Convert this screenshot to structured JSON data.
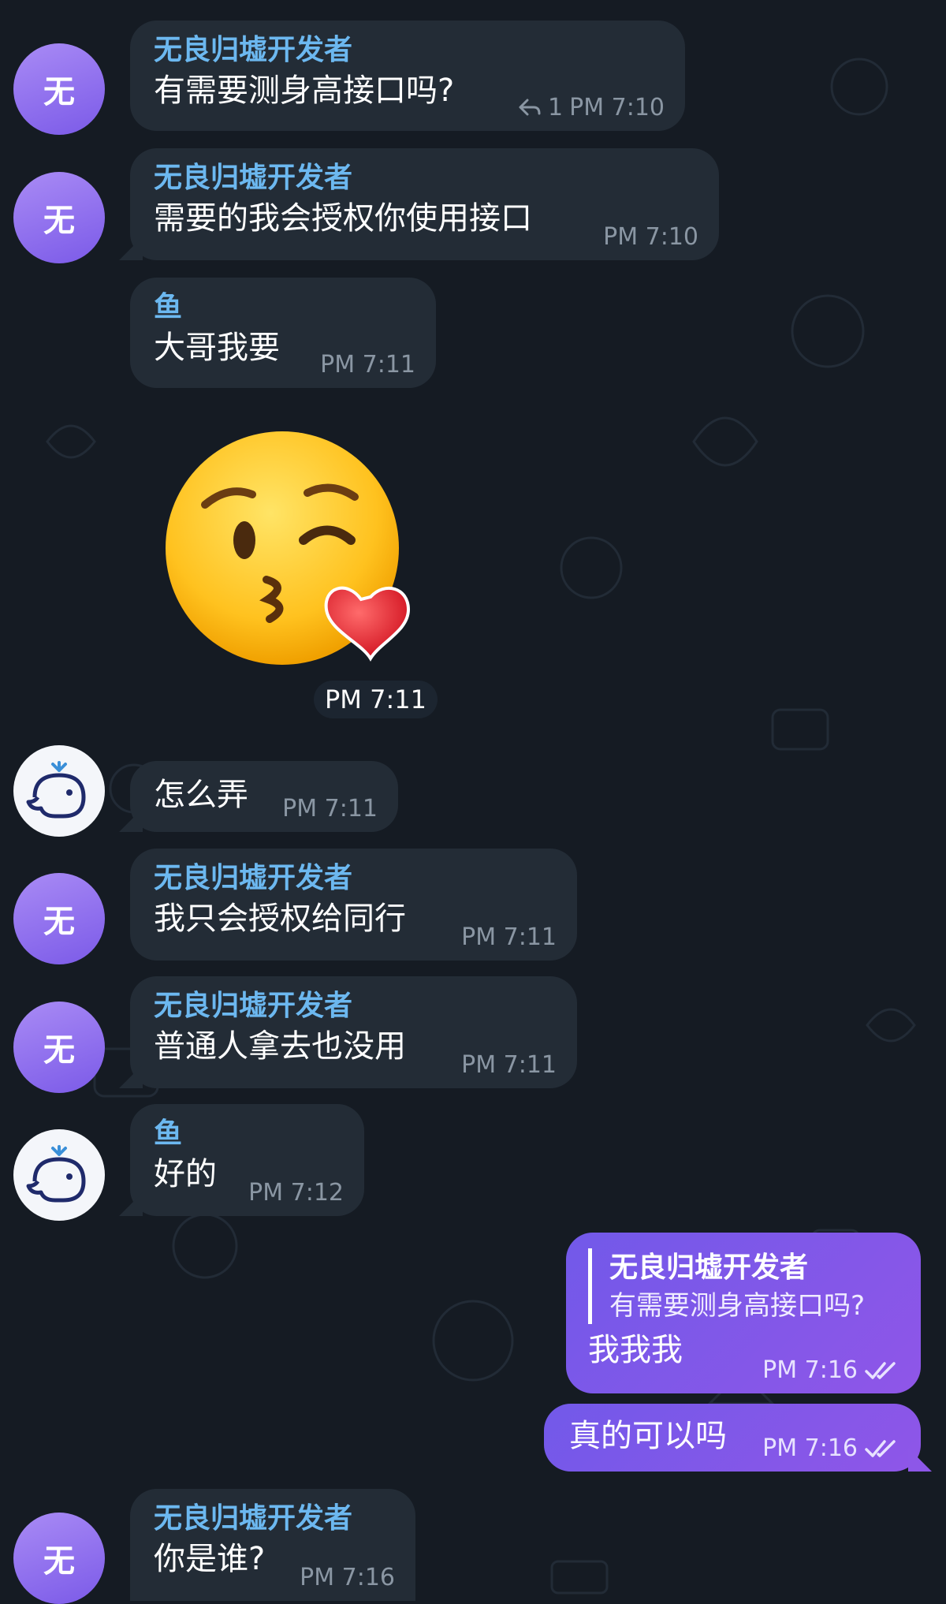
{
  "contacts": {
    "dev": {
      "name": "无良归墟开发者",
      "avatar_char": "无"
    },
    "fish": {
      "name": "鱼"
    }
  },
  "messages": [
    {
      "sender": "无良归墟开发者",
      "text": "有需要测身高接口吗?",
      "reply_count": "1",
      "time": "PM 7:10"
    },
    {
      "sender": "无良归墟开发者",
      "text": "需要的我会授权你使用接口",
      "time": "PM 7:10"
    },
    {
      "sender": "鱼",
      "text": "大哥我要",
      "time": "PM 7:11"
    },
    {
      "type": "sticker",
      "sticker": "kissing-face-with-heart",
      "time": "PM 7:11"
    },
    {
      "text": "怎么弄",
      "time": "PM 7:11"
    },
    {
      "sender": "无良归墟开发者",
      "text": "我只会授权给同行",
      "time": "PM 7:11"
    },
    {
      "sender": "无良归墟开发者",
      "text": "普通人拿去也没用",
      "time": "PM 7:11"
    },
    {
      "sender": "鱼",
      "text": "好的",
      "time": "PM 7:12"
    },
    {
      "outgoing": true,
      "quote_name": "无良归墟开发者",
      "quote_text": "有需要测身高接口吗?",
      "text": "我我我",
      "time": "PM 7:16"
    },
    {
      "outgoing": true,
      "text": "真的可以吗",
      "time": "PM 7:16"
    },
    {
      "sender": "无良归墟开发者",
      "text": "你是谁?",
      "time": "PM 7:16"
    }
  ],
  "colors": {
    "background": "#151b23",
    "incoming": "#232c36",
    "outgoing": "#7a58e9",
    "sender_name": "#6cb8f0"
  }
}
